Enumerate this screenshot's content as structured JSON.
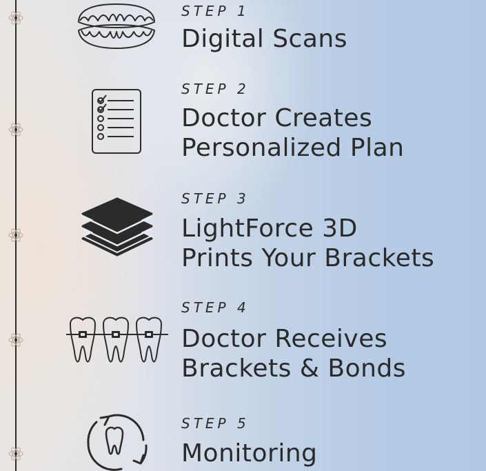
{
  "steps": [
    {
      "label": "STEP 1",
      "title_lines": [
        "Digital Scans"
      ],
      "icon": "dentures-icon"
    },
    {
      "label": "STEP 2",
      "title_lines": [
        "Doctor Creates",
        "Personalized Plan"
      ],
      "icon": "checklist-icon"
    },
    {
      "label": "STEP 3",
      "title_lines": [
        "LightForce 3D",
        "Prints Your Brackets"
      ],
      "icon": "layers-icon"
    },
    {
      "label": "STEP 4",
      "title_lines": [
        "Doctor Receives",
        "Brackets & Bonds"
      ],
      "icon": "teeth-braces-icon"
    },
    {
      "label": "STEP 5",
      "title_lines": [
        "Monitoring"
      ],
      "icon": "tooth-cycle-icon"
    }
  ],
  "colors": {
    "ink": "#2a2a2a",
    "background_blue": "#b5cbe5",
    "background_warm": "#ede2d8"
  }
}
